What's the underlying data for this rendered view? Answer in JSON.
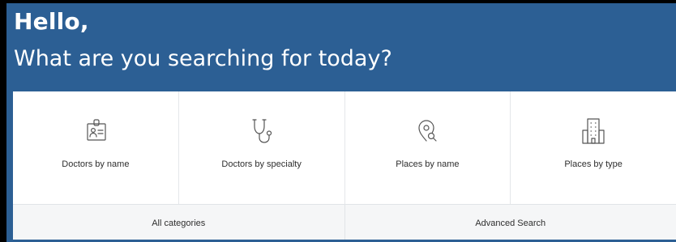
{
  "header": {
    "greeting": "Hello,",
    "subtitle": "What are you searching for today?"
  },
  "categories": [
    {
      "label": "Doctors by name",
      "icon": "id-card-icon"
    },
    {
      "label": "Doctors by specialty",
      "icon": "stethoscope-icon"
    },
    {
      "label": "Places by name",
      "icon": "location-pin-search-icon"
    },
    {
      "label": "Places by type",
      "icon": "building-icon"
    }
  ],
  "links": {
    "all_categories": "All categories",
    "advanced_search": "Advanced Search"
  },
  "colors": {
    "header_bg": "#2c5f94",
    "icon_stroke": "#555555",
    "text": "#2e2e2e"
  }
}
